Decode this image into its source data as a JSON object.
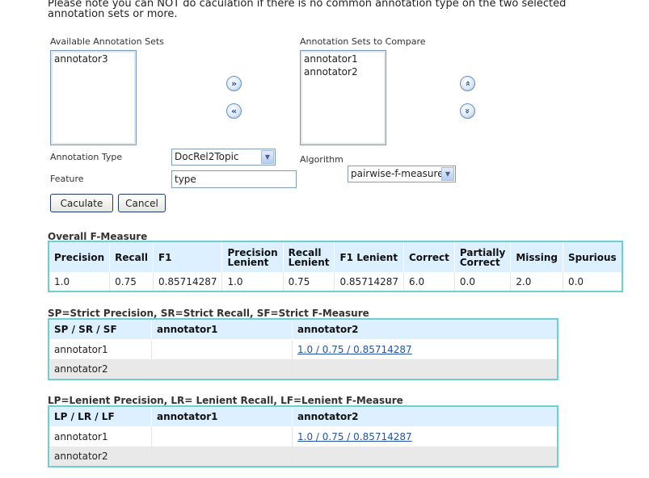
{
  "note": "Please note you can NOT do caculation if there is no common annotation type on the two selected annotation sets or more.",
  "available": {
    "label": "Available Annotation Sets",
    "items": [
      "annotator3"
    ]
  },
  "compare": {
    "label": "Annotation Sets to Compare",
    "items": [
      "annotator1",
      "annotator2"
    ]
  },
  "controls": {
    "annotation_type_label": "Annotation Type",
    "annotation_type_value": "DocRel2Topic",
    "algorithm_label": "Algorithm",
    "algorithm_value": "pairwise-f-measure",
    "feature_label": "Feature",
    "feature_value": "type",
    "calculate_label": "Caculate",
    "cancel_label": "Cancel"
  },
  "icons": {
    "move_right": "double-chevron-right-icon",
    "move_left": "double-chevron-left-icon",
    "move_up": "double-chevron-up-icon",
    "move_down": "double-chevron-down-icon"
  },
  "overall": {
    "title": "Overall F-Measure",
    "headers": [
      "Precision",
      "Recall",
      "F1",
      "Precision Lenient",
      "Recall Lenient",
      "F1 Lenient",
      "Correct",
      "Partially Correct",
      "Missing",
      "Spurious"
    ],
    "values": [
      "1.0",
      "0.75",
      "0.85714287",
      "1.0",
      "0.75",
      "0.85714287",
      "6.0",
      "0.0",
      "2.0",
      "0.0"
    ]
  },
  "strict": {
    "title": "SP=Strict Precision, SR=Strict Recall, SF=Strict F-Measure",
    "headers": [
      "SP / SR / SF",
      "annotator1",
      "annotator2"
    ],
    "rows": [
      {
        "name": "annotator1",
        "c1": "",
        "c2": "1.0 / 0.75 / 0.85714287"
      },
      {
        "name": "annotator2",
        "c1": "",
        "c2": ""
      }
    ]
  },
  "lenient": {
    "title": "LP=Lenient Precision, LR= Lenient Recall, LF=Lenient F-Measure",
    "headers": [
      "LP / LR / LF",
      "annotator1",
      "annotator2"
    ],
    "rows": [
      {
        "name": "annotator1",
        "c1": "",
        "c2": "1.0 / 0.75 / 0.85714287"
      },
      {
        "name": "annotator2",
        "c1": "",
        "c2": ""
      }
    ]
  },
  "colors": {
    "table_border": "#6ccfd0",
    "header_bg": "#dcf0ff",
    "link": "#2255aa",
    "row_alt": "#e9e9e9"
  }
}
